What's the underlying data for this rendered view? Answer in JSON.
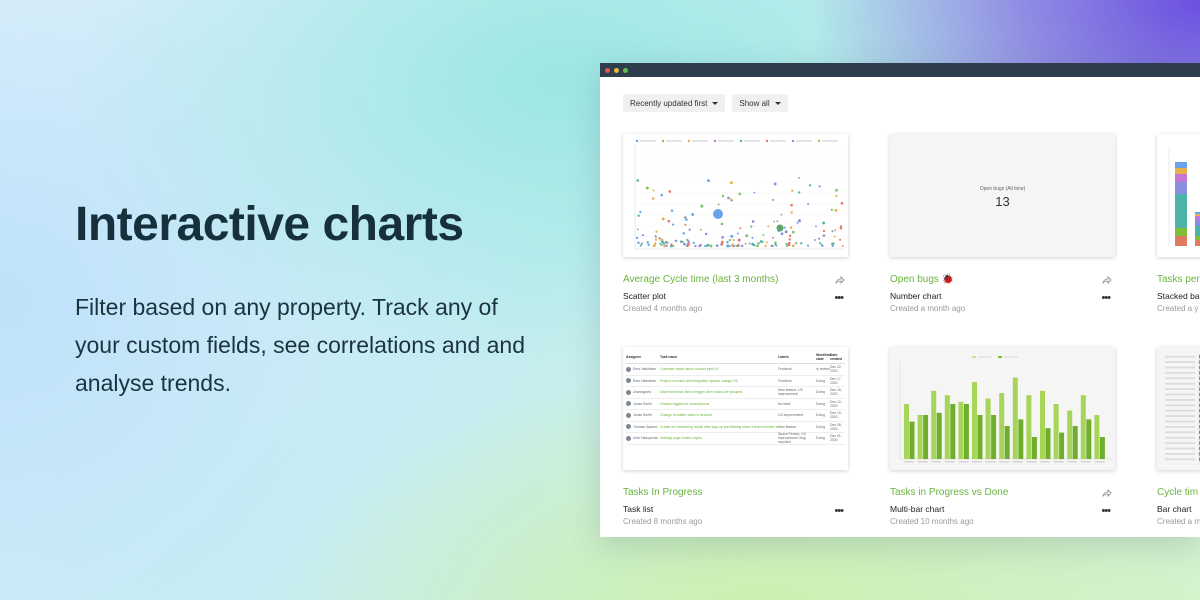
{
  "hero": {
    "title": "Interactive charts",
    "subtitle": "Filter based on any property. Track any of your custom fields, see correlations and and analyse trends."
  },
  "filters": {
    "sort_label": "Recently updated first",
    "show_label": "Show all"
  },
  "cards": [
    {
      "title": "Average Cycle time (last 3 months)",
      "type": "Scatter plot",
      "date": "Created 4 months ago"
    },
    {
      "title": "Open bugs 🐞",
      "type": "Number chart",
      "date": "Created a month ago"
    },
    {
      "title": "Tasks per",
      "type": "Stacked ba",
      "date": "Created a y"
    },
    {
      "title": "Tasks In Progress",
      "type": "Task list",
      "date": "Created 8 months ago"
    },
    {
      "title": "Tasks in Progress vs Done",
      "type": "Multi-bar chart",
      "date": "Created 10 months ago"
    },
    {
      "title": "Cycle tim",
      "type": "Bar chart",
      "date": "Created a m"
    }
  ],
  "number_chart": {
    "label": "Open bugs (All time)",
    "value": "13"
  },
  "task_list": {
    "headers": [
      "Assignee",
      "Task name",
      "Labels",
      "Workflow state",
      "Date created"
    ],
    "rows": [
      [
        "Eero Hakulinen",
        "Customer report about contact input UI",
        "Frontend",
        "In review",
        "Dec 22, 2020"
      ],
      [
        "Eero Hakulinen",
        "Project overview and integration options change UX",
        "Frontend",
        "Doing",
        "Dec 17, 2020"
      ],
      [
        "Unassigned",
        "Dependent task fails to trigger when tasks are grouped",
        "New feature, UX improvement",
        "Doing",
        "Dec 16, 2020"
      ],
      [
        "Jonas Smith",
        "Feature toggles for subscriptions",
        "No label",
        "Doing",
        "Dec 10, 2020"
      ],
      [
        "Jonas Smith",
        "Change formatter dates in account",
        "UX improvement",
        "Doing",
        "Dec 10, 2020"
      ],
      [
        "Tuomas Saarivo",
        "Create an onboarding modal after sign-up and filtering when a team member is added",
        "New feature",
        "Doing",
        "Dec 08, 2020"
      ],
      [
        "Unto Hakuperaa",
        "Settings page broken styles",
        "Space Person, UX improvement, Bug reported",
        "Doing",
        "Dec 01, 2020"
      ]
    ]
  },
  "colors": {
    "accent": "#6ab43c",
    "heading": "#16313c",
    "titlebar": "#2f3e4d"
  }
}
